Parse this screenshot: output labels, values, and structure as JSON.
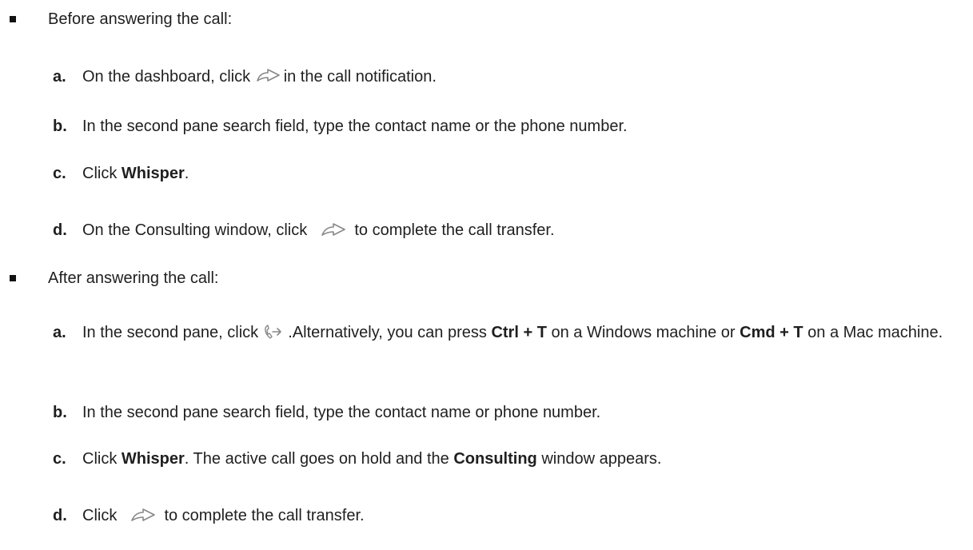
{
  "section_before": {
    "heading": "Before answering the call:",
    "steps": [
      {
        "letter": "a.",
        "pre": "On the dashboard, click ",
        "icon": "transfer-arrow-icon",
        "post": "in the call notification."
      },
      {
        "letter": "b.",
        "text": "In the second pane search field, type the contact name or the phone number."
      },
      {
        "letter": "c.",
        "pre": "Click ",
        "bold": "Whisper",
        "post": "."
      },
      {
        "letter": "d.",
        "pre": "On the Consulting window, click ",
        "icon": "transfer-arrow-icon",
        "post": " to complete the call transfer."
      }
    ]
  },
  "section_after": {
    "heading": "After answering the call:",
    "steps": [
      {
        "letter": "a.",
        "pre": "In the second pane, click ",
        "icon": "phone-transfer-icon",
        "mid1": " .Alternatively, you can press ",
        "bold1": "Ctrl + T",
        "mid2": " on a Windows machine or ",
        "bold2": "Cmd + T",
        "post": " on a Mac machine."
      },
      {
        "letter": "b.",
        "text": "In the second pane search field, type the contact name or phone number."
      },
      {
        "letter": "c.",
        "pre": "Click ",
        "bold1": "Whisper",
        "mid": ". The active call goes on hold and the ",
        "bold2": "Consulting",
        "post": " window appears."
      },
      {
        "letter": "d.",
        "pre": "Click ",
        "icon": "transfer-arrow-icon",
        "post": " to complete the call transfer."
      }
    ]
  }
}
